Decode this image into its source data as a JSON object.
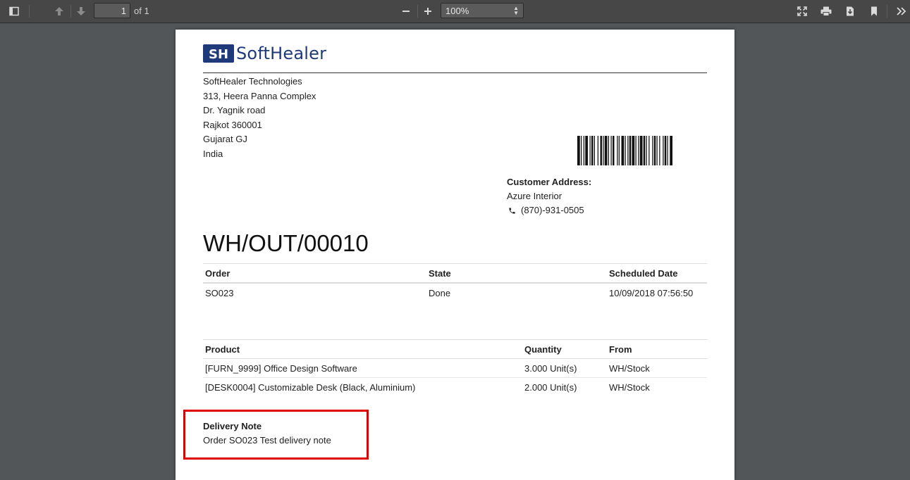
{
  "toolbar": {
    "page_number": "1",
    "page_of": "of 1",
    "zoom": "100%",
    "icons": [
      "sidebar-toggle-icon",
      "previous-page-icon",
      "next-page-icon",
      "zoom-out-icon",
      "zoom-in-icon",
      "fullscreen-icon",
      "print-icon",
      "download-icon",
      "bookmark-icon",
      "more-tools-icon"
    ]
  },
  "document": {
    "logo": {
      "mark": "SH",
      "text": "SoftHealer"
    },
    "company_address": [
      "SoftHealer Technologies",
      "313, Heera Panna Complex",
      "Dr. Yagnik road",
      "Rajkot 360001",
      "Gujarat GJ",
      "India"
    ],
    "customer": {
      "label": "Customer Address:",
      "name": "Azure Interior",
      "phone": "(870)-931-0505"
    },
    "title": "WH/OUT/00010",
    "order_table": {
      "headers": [
        "Order",
        "State",
        "Scheduled Date"
      ],
      "rows": [
        [
          "SO023",
          "Done",
          "10/09/2018 07:56:50"
        ]
      ]
    },
    "product_table": {
      "headers": [
        "Product",
        "Quantity",
        "From"
      ],
      "rows": [
        [
          "[FURN_9999] Office Design Software",
          "3.000 Unit(s)",
          "WH/Stock"
        ],
        [
          "[DESK0004] Customizable Desk (Black, Aluminium)",
          "2.000 Unit(s)",
          "WH/Stock"
        ]
      ]
    },
    "delivery_note": {
      "label": "Delivery Note",
      "text": "Order SO023 Test delivery note"
    }
  },
  "colors": {
    "toolbar_bg": "#474747",
    "viewer_bg": "#525659",
    "highlight": "#e00000",
    "brand": "#1f3a7a"
  }
}
